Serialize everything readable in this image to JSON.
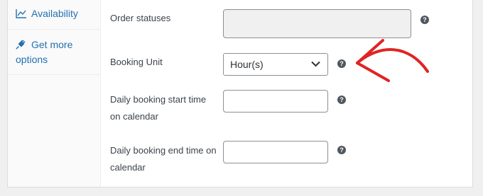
{
  "sidebar": {
    "items": [
      {
        "label": "Availability",
        "icon": "chart-line-icon"
      },
      {
        "label_line1": "Get more",
        "label_line2": "options",
        "icon": "plug-icon"
      }
    ]
  },
  "form": {
    "order_statuses": {
      "label": "Order statuses",
      "help": "?"
    },
    "booking_unit": {
      "label": "Booking Unit",
      "value": "Hour(s)",
      "help": "?"
    },
    "daily_start": {
      "label_line1": "Daily booking start time",
      "label_line2": "on calendar",
      "value": "",
      "help": "?"
    },
    "daily_end": {
      "label_line1": "Daily booking end time on",
      "label_line2": "calendar",
      "value": "",
      "help": "?"
    }
  },
  "annotation": {
    "arrow_color": "#e02424"
  },
  "colors": {
    "link": "#2271b1",
    "help_bg": "#50575e",
    "panel_bg": "#ffffff",
    "page_bg": "#f0f0f1"
  }
}
